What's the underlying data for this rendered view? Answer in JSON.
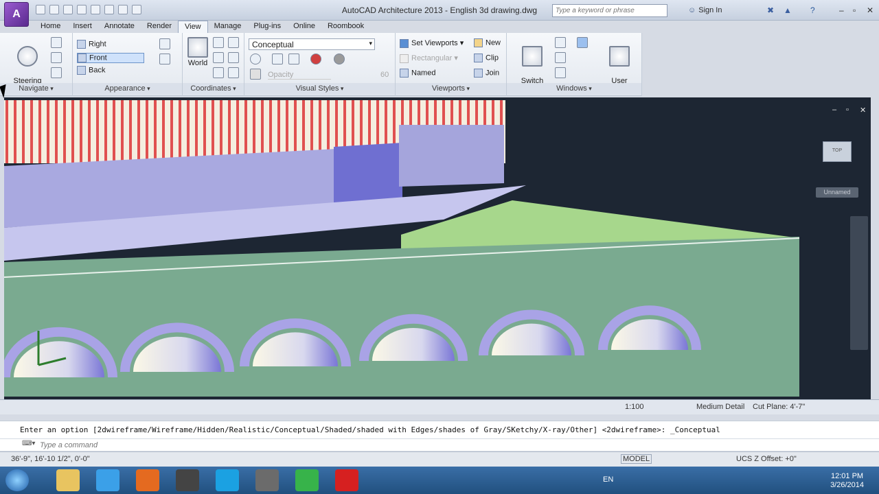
{
  "app": {
    "logo_letter": "A",
    "title": "AutoCAD Architecture 2013 - English   3d drawing.dwg",
    "search_placeholder": "Type a keyword or phrase",
    "sign_in": "Sign In"
  },
  "tabs": [
    {
      "label": "Home"
    },
    {
      "label": "Insert"
    },
    {
      "label": "Annotate"
    },
    {
      "label": "Render"
    },
    {
      "label": "View",
      "active": true
    },
    {
      "label": "Manage"
    },
    {
      "label": "Plug-ins"
    },
    {
      "label": "Online"
    },
    {
      "label": "Roombook"
    }
  ],
  "ribbon": {
    "navigate": {
      "label": "Navigate",
      "steering": "Steering\nWheels"
    },
    "appearance": {
      "label": "Appearance",
      "views": [
        "Right",
        "Front",
        "Back"
      ]
    },
    "coordinates": {
      "label": "Coordinates",
      "world": "World"
    },
    "visual_styles": {
      "label": "Visual Styles",
      "current": "Conceptual",
      "opacity": "Opacity",
      "opacity_value": "60"
    },
    "viewports": {
      "label": "Viewports",
      "set_viewports": "Set Viewports",
      "rectangular": "Rectangular",
      "named": "Named",
      "new": "New",
      "clip": "Clip",
      "join": "Join"
    },
    "windows": {
      "label": "Windows",
      "switch": "Switch\nWindows",
      "user_interface": "User\nInterface"
    }
  },
  "viewport": {
    "viewcube_label": "TOP",
    "unnamed_label": "Unnamed"
  },
  "status_top": {
    "scale": "1:100",
    "detail": "Medium Detail",
    "cut_plane": "Cut Plane: 4'-7\""
  },
  "command": {
    "history": "Enter an option [2dwireframe/Wireframe/Hidden/Realistic/Conceptual/Shaded/shaded with Edges/shades of Gray/SKetchy/X-ray/Other] <2dwireframe>: _Conceptual",
    "placeholder": "Type a command"
  },
  "status_bottom": {
    "coords": "36'-9\",   16'-10 1/2\", 0'-0\"",
    "model": "MODEL",
    "ucs_offset": "UCS Z Offset: +0\""
  },
  "taskbar": {
    "lang": "EN",
    "time": "12:01 PM",
    "date": "3/26/2014"
  }
}
